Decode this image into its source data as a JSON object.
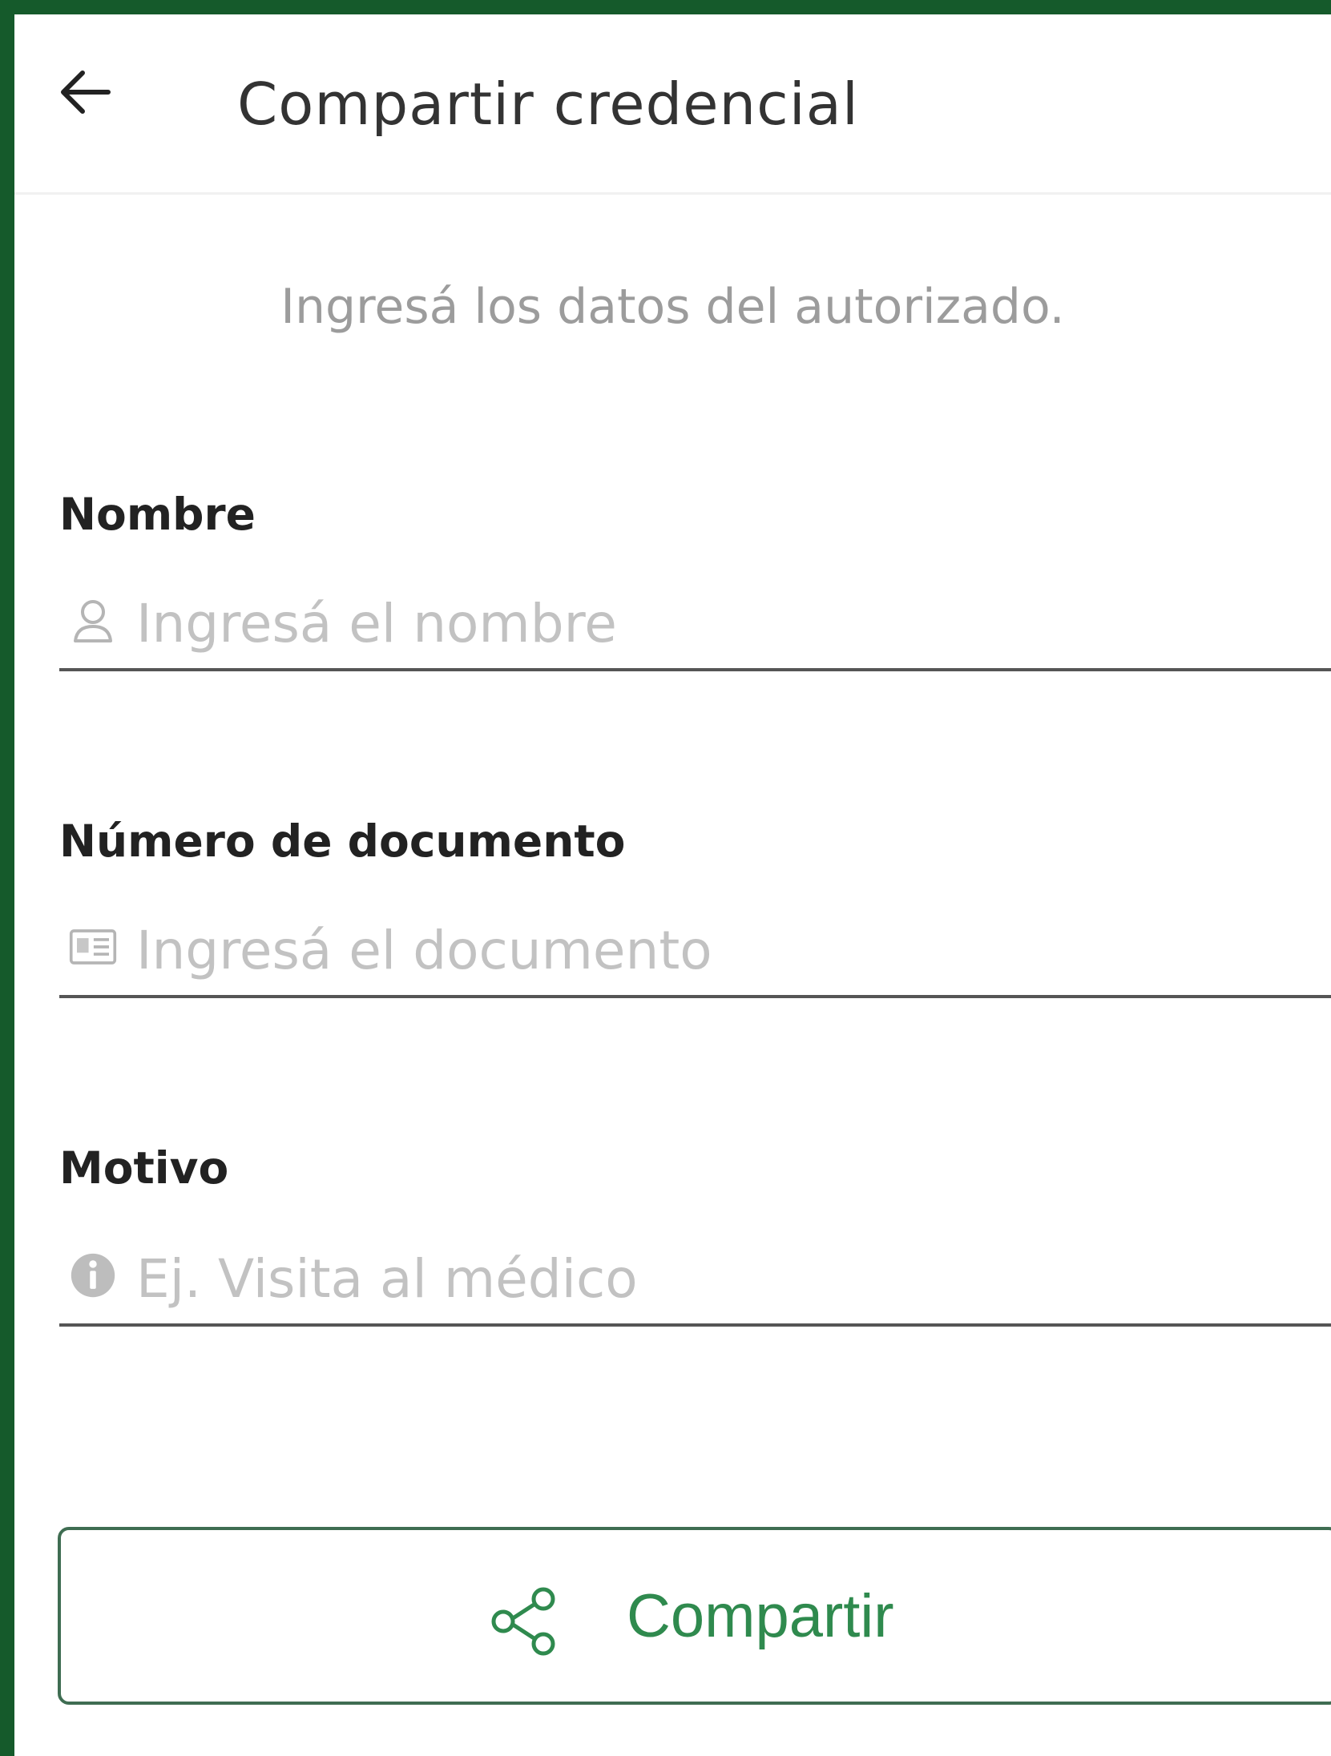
{
  "header": {
    "title": "Compartir credencial",
    "back_icon": "arrow-left-icon"
  },
  "subtitle": "Ingresá los datos del autorizado.",
  "form": {
    "name": {
      "label": "Nombre",
      "placeholder": "Ingresá el nombre",
      "icon": "user-icon"
    },
    "document": {
      "label": "Número de documento",
      "placeholder": "Ingresá el documento",
      "icon": "id-card-icon"
    },
    "reason": {
      "label": "Motivo",
      "placeholder": "Ej. Visita al médico",
      "icon": "info-icon"
    }
  },
  "share_button": {
    "label": "Compartir",
    "icon": "share-icon"
  },
  "colors": {
    "frame": "#155a2b",
    "accent": "#2f8a4e",
    "button_border": "#3f6d52"
  }
}
